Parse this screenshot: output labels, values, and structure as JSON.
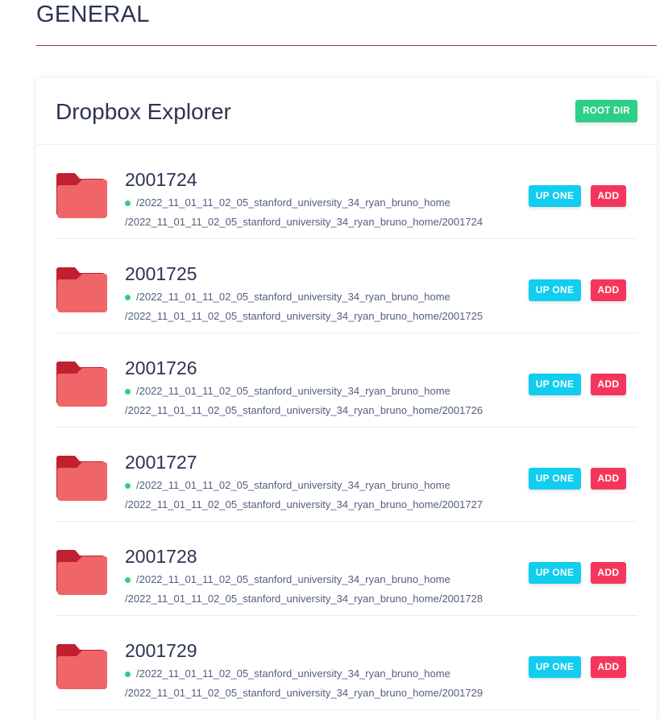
{
  "section": {
    "title": "GENERAL"
  },
  "explorer": {
    "title": "Dropbox Explorer",
    "root_button_label": "ROOT DIR",
    "up_label": "UP ONE",
    "add_label": "ADD",
    "items": [
      {
        "name": "2001724",
        "parent": "/2022_11_01_11_02_05_stanford_university_34_ryan_bruno_home",
        "path": "/2022_11_01_11_02_05_stanford_university_34_ryan_bruno_home/2001724"
      },
      {
        "name": "2001725",
        "parent": "/2022_11_01_11_02_05_stanford_university_34_ryan_bruno_home",
        "path": "/2022_11_01_11_02_05_stanford_university_34_ryan_bruno_home/2001725"
      },
      {
        "name": "2001726",
        "parent": "/2022_11_01_11_02_05_stanford_university_34_ryan_bruno_home",
        "path": "/2022_11_01_11_02_05_stanford_university_34_ryan_bruno_home/2001726"
      },
      {
        "name": "2001727",
        "parent": "/2022_11_01_11_02_05_stanford_university_34_ryan_bruno_home",
        "path": "/2022_11_01_11_02_05_stanford_university_34_ryan_bruno_home/2001727"
      },
      {
        "name": "2001728",
        "parent": "/2022_11_01_11_02_05_stanford_university_34_ryan_bruno_home",
        "path": "/2022_11_01_11_02_05_stanford_university_34_ryan_bruno_home/2001728"
      },
      {
        "name": "2001729",
        "parent": "/2022_11_01_11_02_05_stanford_university_34_ryan_bruno_home",
        "path": "/2022_11_01_11_02_05_stanford_university_34_ryan_bruno_home/2001729"
      }
    ]
  },
  "icons": {
    "folder": "folder-icon",
    "status": "status-dot-icon"
  },
  "colors": {
    "root_button": "#2dce89",
    "up_button": "#11cdef",
    "add_button": "#f5365c",
    "folder_back": "#c0202f",
    "folder_front": "#f06567",
    "status_dot": "#2dce89",
    "divider": "#a0303c"
  }
}
